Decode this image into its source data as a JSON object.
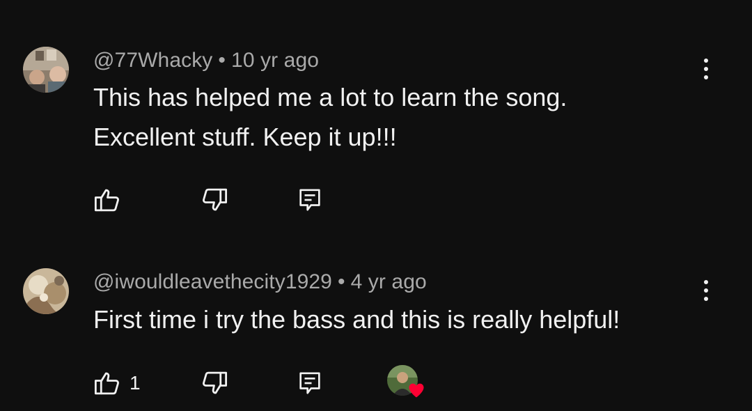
{
  "comments": [
    {
      "handle": "@77Whacky",
      "separator": "•",
      "age": "10 yr ago",
      "text_lines": [
        "This has helped me a lot to learn the song.",
        "Excellent stuff. Keep it up!!!"
      ],
      "like_count": "",
      "creator_heart": false
    },
    {
      "handle": "@iwouldleavethecity1929",
      "separator": "•",
      "age": "4 yr ago",
      "text_lines": [
        "First time i try the bass and this is really helpful!"
      ],
      "like_count": "1",
      "creator_heart": true
    }
  ],
  "icons": {
    "like": "thumbs-up-icon",
    "dislike": "thumbs-down-icon",
    "reply": "reply-icon",
    "more": "more-vert-icon",
    "heart": "heart-icon"
  },
  "colors": {
    "background": "#0f0f0f",
    "primary_text": "#f1f1f1",
    "secondary_text": "#aaaaaa",
    "heart": "#ff0033"
  }
}
